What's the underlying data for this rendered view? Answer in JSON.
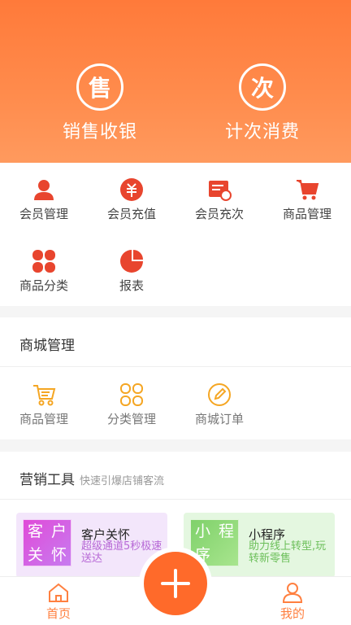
{
  "hero": {
    "sales": {
      "glyph": "售",
      "label": "销售收银"
    },
    "count": {
      "glyph": "次",
      "label": "计次消费"
    }
  },
  "quick_menu": {
    "items": [
      {
        "label": "会员管理",
        "icon": "member-icon"
      },
      {
        "label": "会员充值",
        "icon": "recharge-icon"
      },
      {
        "label": "会员充次",
        "icon": "count-card-icon"
      },
      {
        "label": "商品管理",
        "icon": "cart-icon"
      },
      {
        "label": "商品分类",
        "icon": "category-icon"
      },
      {
        "label": "报表",
        "icon": "pie-chart-icon"
      }
    ],
    "accent": "#e8452e"
  },
  "mall": {
    "title": "商城管理",
    "items": [
      {
        "label": "商品管理",
        "icon": "cart-outline-icon"
      },
      {
        "label": "分类管理",
        "icon": "grid-outline-icon"
      },
      {
        "label": "商城订单",
        "icon": "edit-outline-icon"
      }
    ],
    "accent": "#f5a623"
  },
  "marketing": {
    "title": "营销工具",
    "subtitle": "快速引爆店铺客流",
    "cards": [
      {
        "tile": [
          "客",
          "户",
          "关",
          "怀"
        ],
        "title": "客户关怀",
        "desc": "超级通道5秒极速送达"
      },
      {
        "tile": [
          "小",
          "程",
          "序",
          ""
        ],
        "title": "小程序",
        "desc": "助力线上转型,玩转新零售"
      }
    ]
  },
  "tabbar": {
    "home": "首页",
    "mine": "我的",
    "fab_icon": "plus-icon"
  }
}
